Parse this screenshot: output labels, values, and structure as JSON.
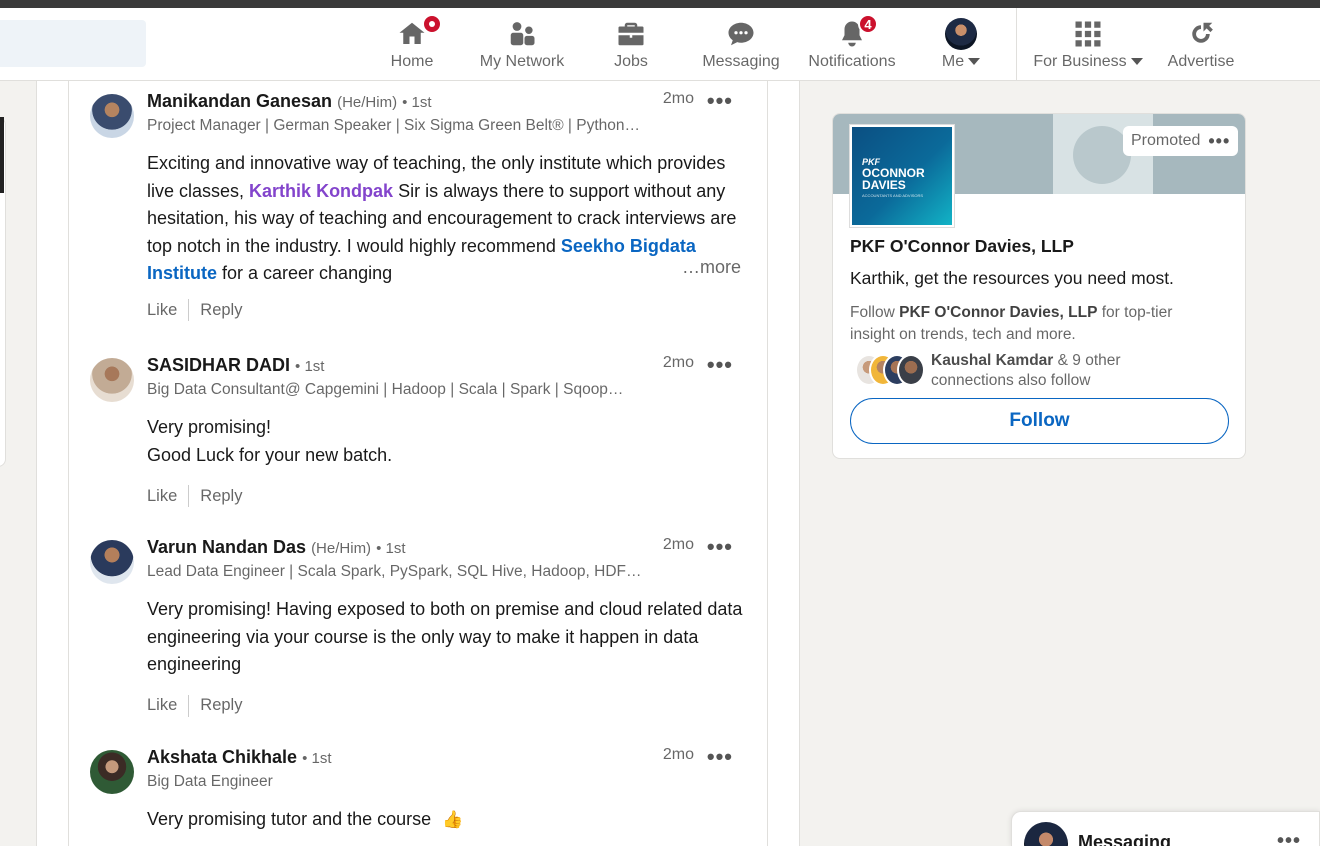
{
  "nav": {
    "items": [
      {
        "label": "Home",
        "icon": "home-icon",
        "badge": ""
      },
      {
        "label": "My Network",
        "icon": "network-icon",
        "badge": ""
      },
      {
        "label": "Jobs",
        "icon": "briefcase-icon",
        "badge": ""
      },
      {
        "label": "Messaging",
        "icon": "chat-icon",
        "badge": ""
      },
      {
        "label": "Notifications",
        "icon": "bell-icon",
        "badge": "4"
      },
      {
        "label": "Me",
        "icon": "avatar",
        "badge": ""
      },
      {
        "label": "For Business",
        "icon": "grid-icon",
        "badge": ""
      },
      {
        "label": "Advertise",
        "icon": "advertise-icon",
        "badge": ""
      }
    ]
  },
  "comments": [
    {
      "name": "Manikandan Ganesan",
      "pronouns": "(He/Him)",
      "degree": "• 1st",
      "headline": "Project Manager | German Speaker | Six Sigma Green Belt® | Python…",
      "time": "2mo",
      "text_1": "Exciting and innovative way of teaching, the only institute which provides live classes, ",
      "mention_person": "Karthik Kondpak",
      "text_2": " Sir is always there to support without any hesitation, his way of teaching and encouragement to crack interviews are top notch in the industry. I would highly recommend ",
      "mention_company": "Seekho Bigdata Institute",
      "text_3": " for a career changing",
      "more": "…more",
      "like": "Like",
      "reply": "Reply"
    },
    {
      "name": "SASIDHAR DADI",
      "pronouns": "",
      "degree": "• 1st",
      "headline": "Big Data Consultant@ Capgemini | Hadoop | Scala | Spark | Sqoop…",
      "time": "2mo",
      "line_1": "Very promising!",
      "line_2": "Good Luck for your new batch.",
      "like": "Like",
      "reply": "Reply"
    },
    {
      "name": "Varun Nandan Das",
      "pronouns": "(He/Him)",
      "degree": "• 1st",
      "headline": "Lead Data Engineer | Scala Spark, PySpark, SQL Hive, Hadoop, HDFS…",
      "time": "2mo",
      "text": "Very promising! Having exposed to both on premise and cloud related data engineering via your course is the only way to make it happen in data engineering",
      "like": "Like",
      "reply": "Reply"
    },
    {
      "name": "Akshata Chikhale",
      "pronouns": "",
      "degree": "• 1st",
      "headline": "Big Data Engineer",
      "time": "2mo",
      "text": "Very promising tutor and the course",
      "emoji": "👍"
    }
  ],
  "ad": {
    "promoted": "Promoted",
    "logo_brand": "PKF",
    "logo_line_1": "OCONNOR",
    "logo_line_2": "DAVIES",
    "logo_tagline": "ACCOUNTANTS AND ADVISORS",
    "company": "PKF O'Connor Davies, LLP",
    "subtitle": "Karthik, get the resources you need most.",
    "desc_1": "Follow ",
    "desc_company": "PKF O'Connor Davies, LLP",
    "desc_2": " for top-tier insight on trends, tech and more.",
    "conn_name": "Kaushal Kamdar",
    "conn_rest": " & 9 other connections also follow",
    "follow": "Follow"
  },
  "messaging": {
    "label": "Messaging"
  }
}
